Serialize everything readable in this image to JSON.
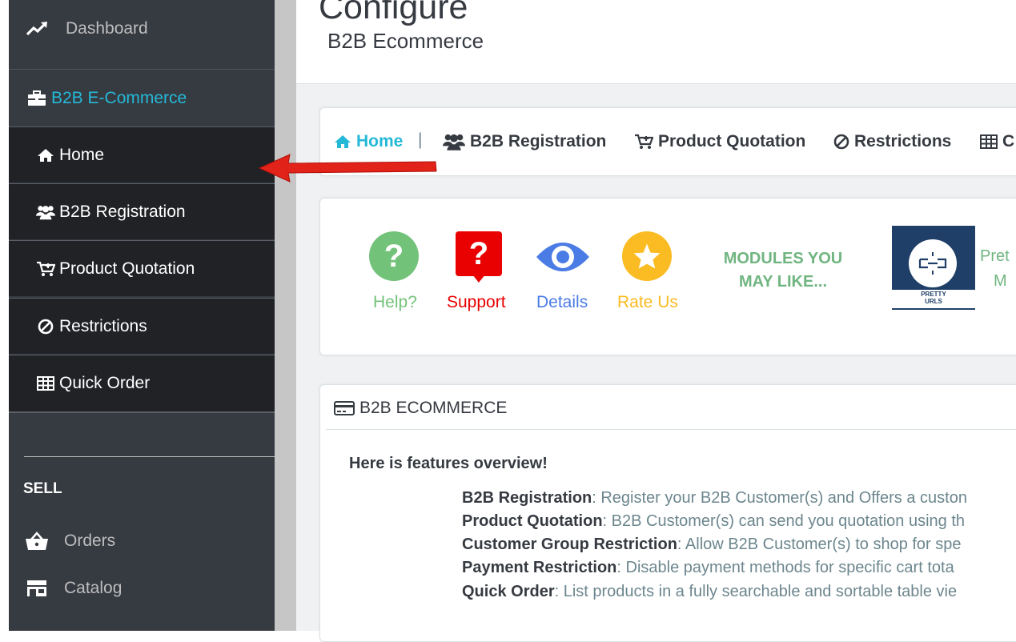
{
  "sidebar": {
    "dashboard": "Dashboard",
    "module": "B2B E-Commerce",
    "sub_items": [
      {
        "label": "Home",
        "icon": "home-icon"
      },
      {
        "label": "B2B Registration",
        "icon": "users-icon"
      },
      {
        "label": "Product Quotation",
        "icon": "cart-icon"
      },
      {
        "label": "Restrictions",
        "icon": "ban-icon"
      },
      {
        "label": "Quick Order",
        "icon": "table-icon"
      }
    ],
    "section": "SELL",
    "orders": "Orders",
    "catalog": "Catalog"
  },
  "header": {
    "title": "Configure",
    "subtitle": "B2B Ecommerce"
  },
  "tabs": {
    "home": "Home",
    "separator": "|",
    "registration": "B2B Registration",
    "quotation": "Product Quotation",
    "restrictions": "Restrictions",
    "quick_order_partial": "C"
  },
  "quicklinks": {
    "help": "Help?",
    "support": "Support",
    "details": "Details",
    "rate": "Rate Us",
    "modules_line1": "MODULES YOU",
    "modules_line2": "MAY LIKE...",
    "thumb_line1": "PRETTY",
    "thumb_line2": "URLS",
    "promo_partial1": "Pret",
    "promo_partial2": "M"
  },
  "panel": {
    "heading": "B2B ECOMMERCE",
    "overview": "Here is features overview!",
    "features": [
      {
        "name": "B2B Registration",
        "desc": ": Register your B2B Customer(s) and Offers a custon"
      },
      {
        "name": "Product Quotation",
        "desc": ": B2B Customer(s) can send you quotation using th"
      },
      {
        "name": "Customer Group Restriction",
        "desc": ": Allow B2B Customer(s) to shop for spe"
      },
      {
        "name": "Payment Restriction",
        "desc": ": Disable payment methods for specific cart tota"
      },
      {
        "name": "Quick Order",
        "desc": ": List products in a fully searchable and sortable table vie"
      }
    ]
  },
  "colors": {
    "sidebar_bg": "#363a41",
    "submenu_bg": "#202226",
    "accent": "#25b9d7",
    "help": "#72c279",
    "support": "#e90000",
    "details": "#4b7be5",
    "rate": "#fbbb22",
    "modules": "#70b580",
    "arrow": "#e2231a"
  }
}
